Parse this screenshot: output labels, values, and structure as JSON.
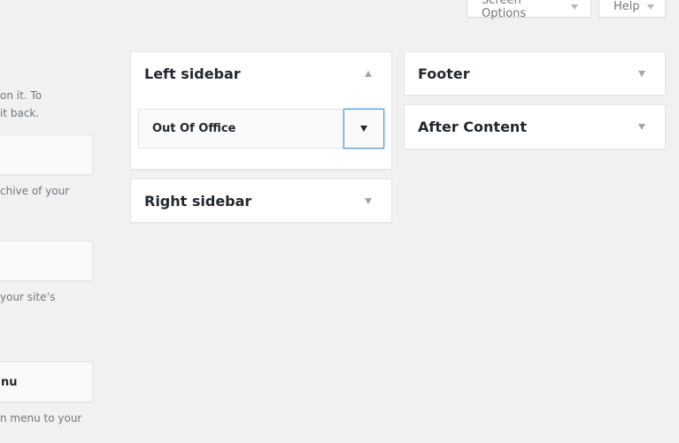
{
  "screen_meta": {
    "screen_options_label": "Screen Options",
    "help_label": "Help"
  },
  "available_widgets": {
    "descriptions": [
      {
        "line1": "on it. To",
        "line2": "it back."
      },
      {
        "line1": "chive of your"
      },
      {
        "line1": "your site’s"
      },
      {
        "line1": "n menu to your"
      }
    ],
    "items": [
      {
        "label": ""
      },
      {
        "label": ""
      },
      {
        "label": "nu"
      }
    ]
  },
  "sidebars": {
    "left": {
      "title": "Left sidebar",
      "expanded": true,
      "widgets": [
        {
          "title": "Out Of Office"
        }
      ]
    },
    "right": {
      "title": "Right sidebar",
      "expanded": false
    },
    "footer": {
      "title": "Footer",
      "expanded": false
    },
    "after_content": {
      "title": "After Content",
      "expanded": false
    }
  }
}
